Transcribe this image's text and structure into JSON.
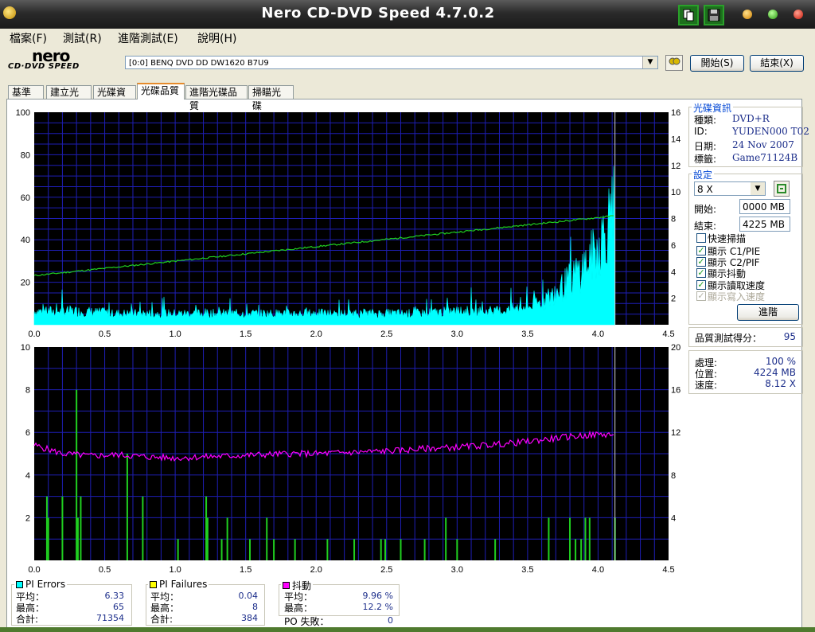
{
  "window": {
    "title": "Nero CD-DVD Speed 4.7.0.2"
  },
  "menu": [
    {
      "label": "檔案(F)"
    },
    {
      "label": "測試(R)"
    },
    {
      "label": "進階測試(E)"
    },
    {
      "label": "說明(H)"
    }
  ],
  "logo": {
    "brand": "nero",
    "sub": "CD·DVD SPEED"
  },
  "toolbar": {
    "drive": "[0:0]   BENQ DVD DD DW1620 B7U9",
    "start_label": "開始(S)",
    "exit_label": "結束(X)"
  },
  "tabs": [
    {
      "label": "基準"
    },
    {
      "label": "建立光碟"
    },
    {
      "label": "光碟資訊"
    },
    {
      "label": "光碟品質"
    },
    {
      "label": "進階光碟品質"
    },
    {
      "label": "掃瞄光碟"
    }
  ],
  "disc_info": {
    "title": "光碟資訊",
    "rows": [
      {
        "label": "種類:",
        "value": "DVD+R"
      },
      {
        "label": "ID:",
        "value": "YUDEN000 T02"
      },
      {
        "label": "日期:",
        "value": "24 Nov 2007"
      },
      {
        "label": "標籤:",
        "value": "Game71124B"
      }
    ]
  },
  "settings": {
    "title": "設定",
    "speed": "8 X",
    "start_label": "開始:",
    "start_value": "0000 MB",
    "end_label": "結束:",
    "end_value": "4225 MB",
    "checkboxes": [
      {
        "label": "快速掃描",
        "checked": false,
        "enabled": true
      },
      {
        "label": "顯示 C1/PIE",
        "checked": true,
        "enabled": true
      },
      {
        "label": "顯示 C2/PIF",
        "checked": true,
        "enabled": true
      },
      {
        "label": "顯示抖動",
        "checked": true,
        "enabled": true
      },
      {
        "label": "顯示讀取速度",
        "checked": true,
        "enabled": true
      },
      {
        "label": "顯示寫入速度",
        "checked": true,
        "enabled": false
      }
    ],
    "advanced_label": "進階"
  },
  "quality": {
    "label": "品質測試得分：",
    "value": "95"
  },
  "progress": {
    "rows": [
      {
        "label": "處理:",
        "value": "100 %"
      },
      {
        "label": "位置:",
        "value": "4224 MB"
      },
      {
        "label": "速度:",
        "value": "8.12 X"
      }
    ]
  },
  "stats": {
    "pi_errors": {
      "title": "PI Errors",
      "color": "#00ffff",
      "avg_label": "平均：",
      "avg": "6.33",
      "max_label": "最高：",
      "max": "65",
      "total_label": "合計:",
      "total": "71354"
    },
    "pi_failures": {
      "title": "PI Failures",
      "color": "#ffff00",
      "avg_label": "平均：",
      "avg": "0.04",
      "max_label": "最高：",
      "max": "8",
      "total_label": "合計:",
      "total": "384"
    },
    "jitter": {
      "title": "抖動",
      "color": "#ff00ff",
      "avg_label": "平均：",
      "avg": "9.96 %",
      "max_label": "最高：",
      "max": "12.2 %",
      "po_label": "PO 失敗：",
      "po": "0"
    }
  },
  "colors": {
    "pie": "#00ffff",
    "read_speed": "#20d020",
    "pif": "#20d020",
    "jitter": "#ff00ff",
    "grid": "#1e1eb4",
    "plot_bg": "#000000"
  },
  "chart_data": [
    {
      "type": "area",
      "title": "",
      "xlim": [
        0,
        4.5
      ],
      "ylim_left": [
        0,
        100
      ],
      "ylim_right": [
        0,
        16
      ],
      "x_ticks": [
        "0.0",
        "0.5",
        "1.0",
        "1.5",
        "2.0",
        "2.5",
        "3.0",
        "3.5",
        "4.0",
        "4.5"
      ],
      "y_ticks_left": [
        "100",
        "80",
        "60",
        "40",
        "20"
      ],
      "y_ticks_right": [
        "16",
        "14",
        "12",
        "10",
        "8",
        "6",
        "4",
        "2"
      ],
      "grid": true,
      "series": [
        {
          "x": [
            0.0,
            0.3,
            0.6,
            0.9,
            1.2,
            1.5,
            1.8,
            2.1,
            2.4,
            2.7,
            3.0,
            3.3,
            3.5,
            3.6,
            3.7,
            3.8,
            3.9,
            4.0,
            4.05,
            4.1,
            4.12
          ],
          "values": [
            6,
            6,
            5,
            5,
            5,
            5,
            5,
            5,
            5,
            5,
            6,
            6,
            8,
            10,
            14,
            20,
            26,
            34,
            42,
            50,
            40
          ]
        },
        {
          "x": [
            0.0,
            4.12
          ],
          "values": [
            3.7,
            8.2
          ]
        }
      ],
      "end_x": 4.12
    },
    {
      "type": "bar",
      "title": "",
      "xlim": [
        0,
        4.5
      ],
      "ylim_left": [
        0,
        10
      ],
      "ylim_right": [
        0,
        20
      ],
      "x_ticks": [
        "0.0",
        "0.5",
        "1.0",
        "1.5",
        "2.0",
        "2.5",
        "3.0",
        "3.5",
        "4.0",
        "4.5"
      ],
      "y_ticks_left": [
        "10",
        "8",
        "6",
        "4",
        "2"
      ],
      "y_ticks_right": [
        "20",
        "16",
        "12",
        "8",
        "4"
      ],
      "grid": true,
      "series": [
        {
          "x": [
            0.09,
            0.1,
            0.2,
            0.3,
            0.31,
            0.33,
            0.66,
            0.77,
            1.02,
            1.22,
            1.23,
            1.33,
            1.37,
            1.53,
            1.65,
            1.7,
            1.85,
            2.08,
            2.27,
            2.46,
            2.49,
            2.6,
            2.77,
            2.92,
            3.0,
            3.27,
            3.65,
            3.8,
            3.84,
            3.88,
            3.91,
            3.94,
            4.12
          ],
          "values": [
            3,
            2,
            3,
            8,
            2,
            3,
            5,
            3,
            1,
            3,
            2,
            1,
            2,
            1,
            2,
            1,
            1,
            1,
            1,
            1,
            1,
            1,
            1,
            2,
            1,
            1,
            2,
            2,
            1,
            1,
            2,
            2,
            2
          ]
        },
        {
          "x": [
            0.0,
            0.2,
            0.4,
            0.6,
            0.8,
            1.0,
            1.2,
            1.4,
            1.6,
            1.8,
            2.0,
            2.2,
            2.4,
            2.6,
            2.8,
            3.0,
            3.2,
            3.4,
            3.6,
            3.8,
            4.0,
            4.12
          ],
          "values": [
            10.8,
            10.0,
            9.8,
            9.9,
            9.7,
            9.6,
            9.7,
            9.8,
            9.9,
            10.0,
            10.0,
            10.1,
            10.2,
            10.3,
            10.5,
            10.6,
            10.8,
            11.0,
            11.3,
            11.6,
            11.8,
            11.8
          ]
        }
      ],
      "end_x": 4.12
    }
  ]
}
